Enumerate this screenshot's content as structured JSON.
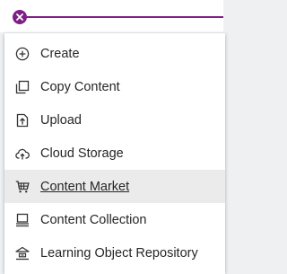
{
  "colors": {
    "accent": "#7e1f86",
    "hover_bg": "#ebebeb",
    "text": "#262626"
  },
  "header": {
    "close_icon": "close-icon"
  },
  "menu": {
    "items": [
      {
        "label": "Create",
        "icon": "plus-circle-icon"
      },
      {
        "label": "Copy Content",
        "icon": "copy-icon"
      },
      {
        "label": "Upload",
        "icon": "upload-icon"
      },
      {
        "label": "Cloud Storage",
        "icon": "cloud-upload-icon"
      },
      {
        "label": "Content Market",
        "icon": "cart-icon",
        "hovered": true
      },
      {
        "label": "Content Collection",
        "icon": "collection-icon"
      },
      {
        "label": "Learning Object Repository",
        "icon": "repository-icon"
      }
    ]
  }
}
